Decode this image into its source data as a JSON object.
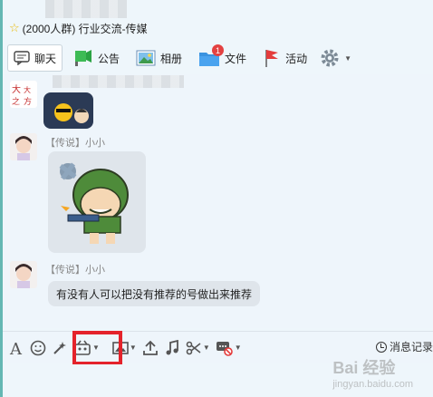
{
  "window": {
    "group_title": "(2000人群) 行业交流-传媒"
  },
  "tabs": [
    {
      "label": "聊天",
      "icon": "chat-icon",
      "active": true
    },
    {
      "label": "公告",
      "icon": "announcement-icon"
    },
    {
      "label": "相册",
      "icon": "album-icon"
    },
    {
      "label": "文件",
      "icon": "folder-icon",
      "badge": "1"
    },
    {
      "label": "活动",
      "icon": "flag-icon"
    }
  ],
  "messages": [
    {
      "sender": "【传说】小小",
      "type": "sticker",
      "sticker": "soldier-sticker"
    },
    {
      "sender": "【传说】小小",
      "type": "text",
      "text": "有没有人可以把没有推荐的号做出来推荐"
    }
  ],
  "compose_toolbar": {
    "icons": [
      "font-icon",
      "emoji-icon",
      "magic-emoticon-icon",
      "gif-sticker-icon",
      "image-icon",
      "upload-icon",
      "music-icon",
      "screenshot-scissors-icon",
      "block-message-icon"
    ],
    "history_label": "消息记录"
  },
  "watermark": {
    "text": "Bai 经验",
    "sub": "jingyan.baidu.com"
  },
  "colors": {
    "accent": "#3a8ee6",
    "badge": "#e34141",
    "highlight": "#e4232b",
    "left_edge": "#64b7b3"
  }
}
